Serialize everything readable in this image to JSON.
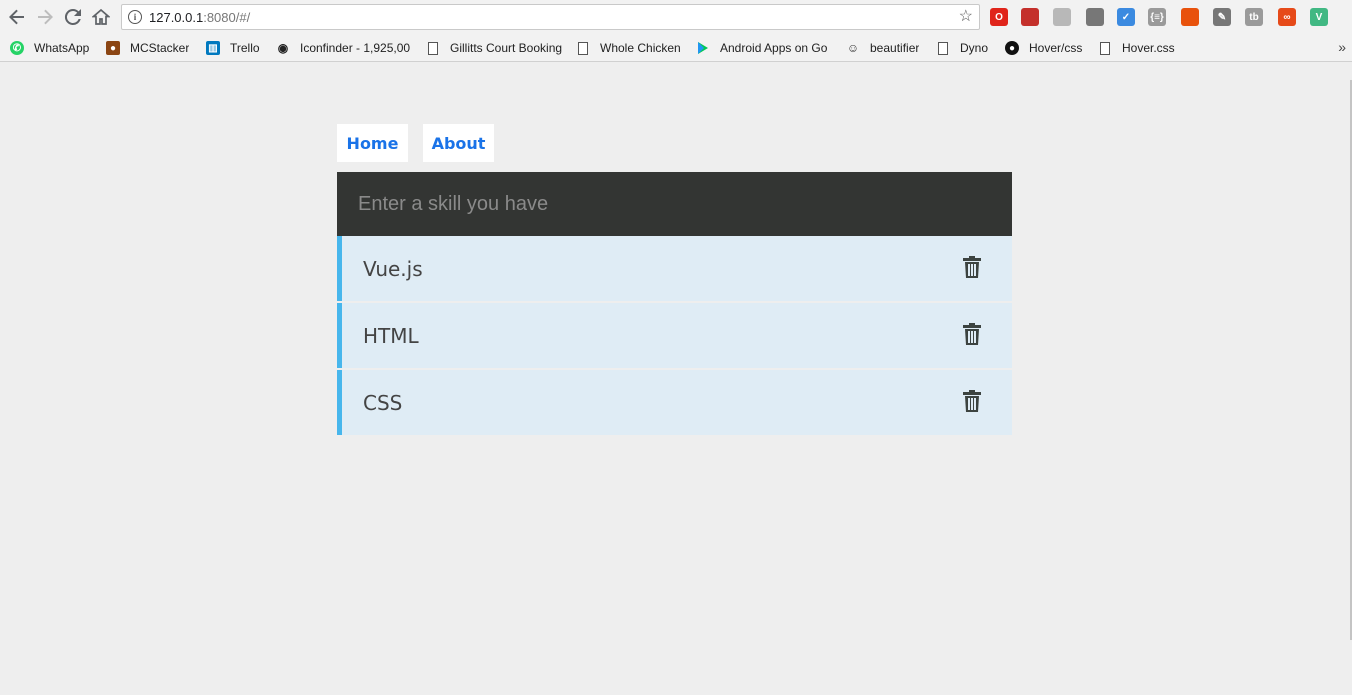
{
  "browser": {
    "url_host": "127.0.0.1",
    "url_rest": ":8080/#/",
    "info_icon": "i",
    "star_icon": "star-icon",
    "extensions": [
      {
        "name": "opera-icon",
        "glyph": "O",
        "color": "#e0251b"
      },
      {
        "name": "adblock-icon",
        "glyph": "",
        "color": "#c4302b"
      },
      {
        "name": "pdf-icon",
        "glyph": "",
        "color": "#b8b8b8"
      },
      {
        "name": "settings-ext-icon",
        "glyph": "",
        "color": "#777777"
      },
      {
        "name": "check-ext-icon",
        "glyph": "✓",
        "color": "#3b8ae0"
      },
      {
        "name": "json-ext-icon",
        "glyph": "{≡}",
        "color": "#9a9a9a"
      },
      {
        "name": "off-ext-icon",
        "glyph": "",
        "color": "#e8520c"
      },
      {
        "name": "pen-ext-icon",
        "glyph": "✎",
        "color": "#777777"
      },
      {
        "name": "tb-ext-icon",
        "glyph": "tb",
        "color": "#9a9a9a"
      },
      {
        "name": "infinity-ext-icon",
        "glyph": "∞",
        "color": "#e64a19"
      },
      {
        "name": "vue-devtools-icon",
        "glyph": "V",
        "color": "#41b883"
      }
    ]
  },
  "bookmarks": [
    {
      "label": "WhatsApp",
      "icon": "whatsapp-icon",
      "color": "#25d366"
    },
    {
      "label": "MCStacker",
      "icon": "mcstacker-icon",
      "color": "#8b4513"
    },
    {
      "label": "Trello",
      "icon": "trello-icon",
      "color": "#0079bf"
    },
    {
      "label": "Iconfinder - 1,925,00",
      "icon": "iconfinder-icon",
      "color": "#222222"
    },
    {
      "label": "Gillitts Court Booking",
      "icon": "page-icon",
      "color": ""
    },
    {
      "label": "Whole Chicken",
      "icon": "page-icon",
      "color": ""
    },
    {
      "label": "Android Apps on Go",
      "icon": "play-store-icon",
      "color": "#00c853"
    },
    {
      "label": "beautifier",
      "icon": "beautifier-icon",
      "color": "#333333"
    },
    {
      "label": "Dyno",
      "icon": "page-icon",
      "color": ""
    },
    {
      "label": "Hover/css",
      "icon": "github-icon",
      "color": "#111111"
    },
    {
      "label": "Hover.css",
      "icon": "page-icon",
      "color": ""
    }
  ],
  "more_bookmarks": "»",
  "nav": {
    "home": "Home",
    "about": "About"
  },
  "input": {
    "placeholder": "Enter a skill you have",
    "value": ""
  },
  "skills": [
    {
      "name": "Vue.js"
    },
    {
      "name": "HTML"
    },
    {
      "name": "CSS"
    }
  ],
  "colors": {
    "accent": "#47b6ec",
    "link": "#1a73e8",
    "input_bg": "#333533",
    "item_bg": "#dfecf5",
    "page_bg": "#eeeeee"
  }
}
